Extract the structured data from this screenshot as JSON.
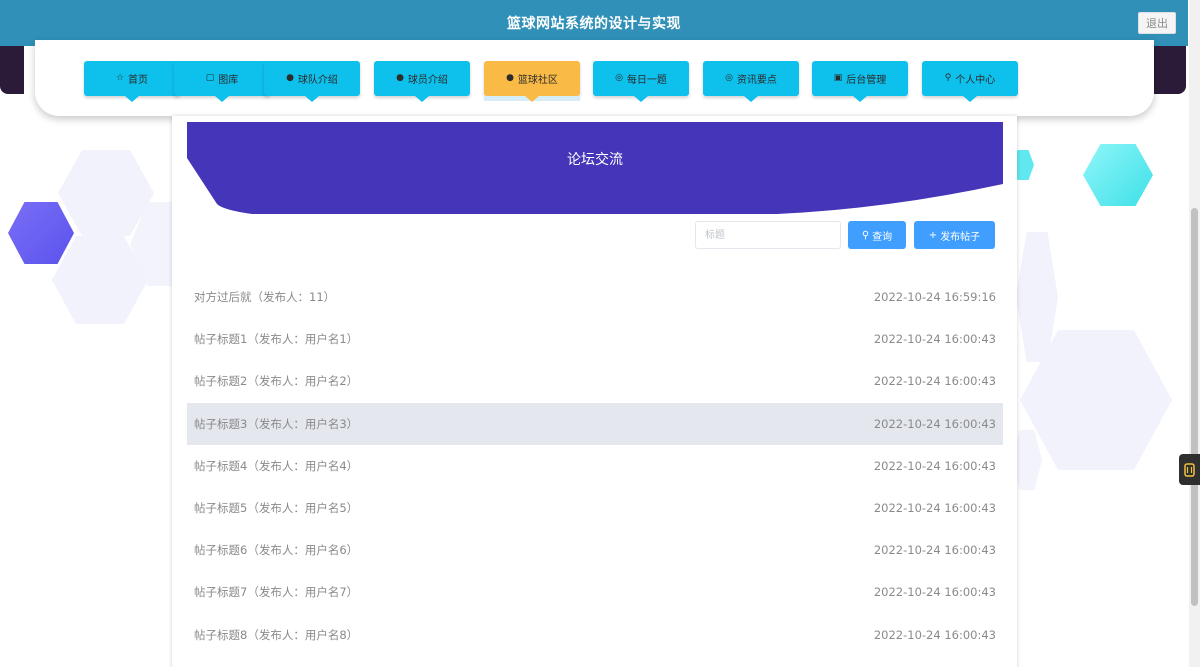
{
  "header": {
    "title": "篮球网站系统的设计与实现",
    "logout_label": "退出"
  },
  "nav": {
    "items": [
      {
        "label": "首页",
        "icon": "star-icon",
        "glyph": "☆"
      },
      {
        "label": "图库",
        "icon": "bag-icon",
        "glyph": "▢"
      },
      {
        "label": "球队介绍",
        "icon": "info-icon",
        "glyph": "●"
      },
      {
        "label": "球员介绍",
        "icon": "question-icon",
        "glyph": "●"
      },
      {
        "label": "篮球社区",
        "icon": "info-icon",
        "glyph": "●"
      },
      {
        "label": "每日一题",
        "icon": "globe-icon",
        "glyph": "◎"
      },
      {
        "label": "资讯要点",
        "icon": "smile-icon",
        "glyph": "◎"
      },
      {
        "label": "后台管理",
        "icon": "box-icon",
        "glyph": "▣"
      },
      {
        "label": "个人中心",
        "icon": "user-icon",
        "glyph": "⚲"
      }
    ],
    "active_index": 4
  },
  "forum": {
    "banner_title": "论坛交流",
    "search_placeholder": "标题",
    "search_button": "查询",
    "post_button": "发布帖子",
    "colors": {
      "banner": "#4535b9",
      "button": "#409eff",
      "nav": "#0ec0ec",
      "nav_active": "#fabb46",
      "header": "#3090b7"
    }
  },
  "posts": [
    {
      "title": "对方过后就（发布人：11）",
      "time": "2022-10-24 16:59:16"
    },
    {
      "title": "帖子标题1（发布人：用户名1）",
      "time": "2022-10-24 16:00:43"
    },
    {
      "title": "帖子标题2（发布人：用户名2）",
      "time": "2022-10-24 16:00:43"
    },
    {
      "title": "帖子标题3（发布人：用户名3）",
      "time": "2022-10-24 16:00:43"
    },
    {
      "title": "帖子标题4（发布人：用户名4）",
      "time": "2022-10-24 16:00:43"
    },
    {
      "title": "帖子标题5（发布人：用户名5）",
      "time": "2022-10-24 16:00:43"
    },
    {
      "title": "帖子标题6（发布人：用户名6）",
      "time": "2022-10-24 16:00:43"
    },
    {
      "title": "帖子标题7（发布人：用户名7）",
      "time": "2022-10-24 16:00:43"
    },
    {
      "title": "帖子标题8（发布人：用户名8）",
      "time": "2022-10-24 16:00:43"
    }
  ],
  "hovered_post_index": 3
}
